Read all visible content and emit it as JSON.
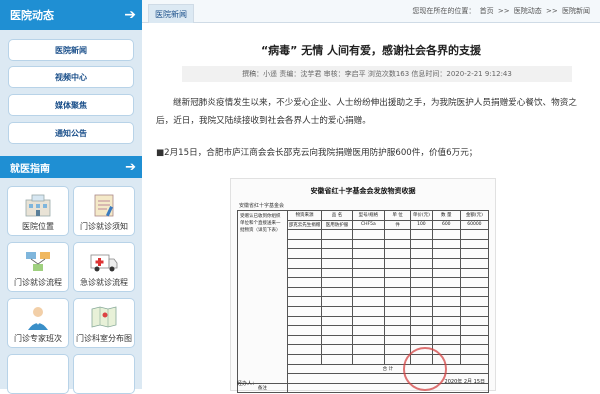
{
  "sidebar": {
    "hospital_news_title": "医院动态",
    "news_items": [
      {
        "label": "医院新闻"
      },
      {
        "label": "视频中心"
      },
      {
        "label": "媒体聚焦"
      },
      {
        "label": "通知公告"
      }
    ],
    "guide_title": "就医指南",
    "guide_items": [
      {
        "label": "医院位置",
        "icon": "hospital-building-icon"
      },
      {
        "label": "门诊就诊须知",
        "icon": "notebook-icon"
      },
      {
        "label": "门诊就诊流程",
        "icon": "flowchart-icon"
      },
      {
        "label": "急诊就诊流程",
        "icon": "ambulance-icon"
      },
      {
        "label": "门诊专家班次",
        "icon": "doctor-icon"
      },
      {
        "label": "门诊科室分布图",
        "icon": "map-icon"
      }
    ]
  },
  "header": {
    "tab_label": "医院新闻",
    "breadcrumb_prefix": "您现在所在的位置：",
    "breadcrumb": [
      "首页",
      ">>",
      "医院动态",
      ">>",
      "医院新闻"
    ]
  },
  "article": {
    "title": "“病毒” 无情 人间有爱，感谢社会各界的支援",
    "meta": "撰稿：小遥 责编：沈芋君 审核：李启平 浏览次数163 信息时间：2020-2-21 9:12:43",
    "intro": "继新冠肺炎疫情发生以来，不少爱心企业、人士纷纷伸出援助之手，为我院医护人员捐赠爱心餐饮、物资之后，近日，我院又陆续接收到社会各界人士的爱心捐赠。",
    "item": "■2月15日，合肥市庐江商会会长邵克云向我院捐赠医用防护服600件，价值6万元；"
  },
  "document": {
    "title": "安徽省红十字基金会发放物资收据",
    "org": "安徽省红十字基金会",
    "left_note": "受赠认已收到你组织单位和个直接送来一批物资（详见下表）",
    "headers": [
      "物资来源",
      "品 名",
      "型号/规格",
      "单 位",
      "单价(元)",
      "数 量",
      "金额(元)"
    ],
    "row": [
      "邵克云先生捐赠",
      "医用防护服",
      "CHF5a",
      "件",
      "100",
      "600",
      "60000"
    ],
    "total_label": "合 计",
    "remark_label": "备注",
    "signer": "经办人：",
    "date": "2020年 2月 15日",
    "colors": {
      "stamp": "#d44444"
    }
  },
  "colors": {
    "accent": "#1f8fd3",
    "sidebar_bg": "#dce9f3",
    "nav_text": "#1a4f8a"
  }
}
